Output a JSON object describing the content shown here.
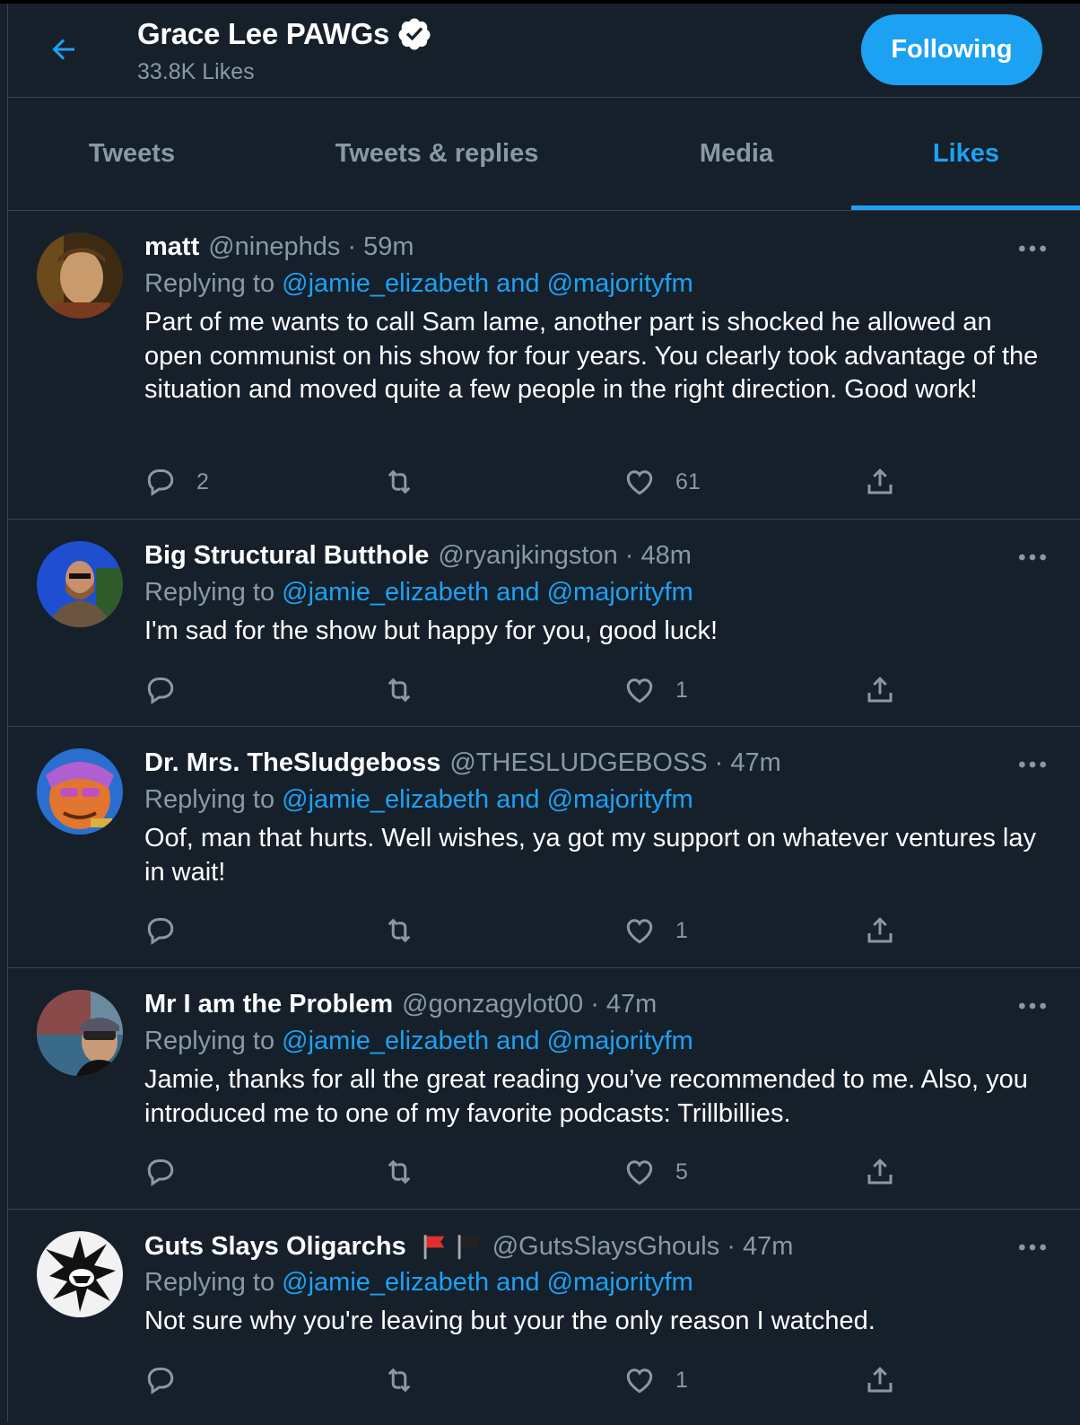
{
  "header": {
    "title": "Grace Lee PAWGs",
    "subtitle": "33.8K Likes",
    "follow_label": "Following"
  },
  "tabs": [
    {
      "label": "Tweets",
      "active": false
    },
    {
      "label": "Tweets & replies",
      "active": false
    },
    {
      "label": "Media",
      "active": false
    },
    {
      "label": "Likes",
      "active": true
    }
  ],
  "tweets": [
    {
      "name": "matt",
      "handle_time": "@ninephds · 59m",
      "replying_prefix": "Replying to ",
      "replying_to": "@jamie_elizabeth and @majorityfm",
      "text": "Part of me wants to call Sam lame, another part is shocked he allowed an open communist on his show for four years. You clearly took advantage of the situation and moved quite a few people in the right direction. Good work!",
      "replies": "2",
      "retweets": "",
      "likes": "61"
    },
    {
      "name": "Big Structural Butthole",
      "handle_time": "@ryanjkingston · 48m",
      "replying_prefix": "Replying to ",
      "replying_to": "@jamie_elizabeth and @majorityfm",
      "text": "I'm sad for the show but happy for you, good luck!",
      "replies": "",
      "retweets": "",
      "likes": "1"
    },
    {
      "name": "Dr. Mrs. TheSludgeboss",
      "handle_time": "@THESLUDGEBOSS · 47m",
      "replying_prefix": "Replying to ",
      "replying_to": "@jamie_elizabeth and @majorityfm",
      "text": "Oof, man that hurts. Well wishes, ya got my support on whatever ventures lay in wait!",
      "replies": "",
      "retweets": "",
      "likes": "1"
    },
    {
      "name": "Mr I am the Problem",
      "handle_time": "@gonzagylot00 · 47m",
      "replying_prefix": "Replying to ",
      "replying_to": "@jamie_elizabeth and @majorityfm",
      "text": "Jamie, thanks for all the great reading you’ve recommended to me. Also, you introduced me to one of my favorite podcasts: Trillbillies.",
      "replies": "",
      "retweets": "",
      "likes": "5"
    },
    {
      "name": "Guts Slays Oligarchs",
      "handle_time": "@GutsSlaysGhouls · 47m",
      "replying_prefix": "Replying to ",
      "replying_to": "@jamie_elizabeth and @majorityfm",
      "text": "Not sure why you're leaving but your the only reason I watched.",
      "replies": "",
      "retweets": "",
      "likes": "1"
    }
  ],
  "icons": {
    "back": "arrow-left-icon",
    "verified": "verified-badge-icon",
    "more": "more-dots-icon",
    "reply": "reply-icon",
    "retweet": "retweet-icon",
    "like": "heart-icon",
    "share": "share-icon",
    "flags": [
      "red-flag-icon",
      "black-flag-icon"
    ]
  },
  "colors": {
    "background": "#15202b",
    "accent": "#1da1f2",
    "muted": "#8899a6",
    "divider": "#38444d"
  }
}
